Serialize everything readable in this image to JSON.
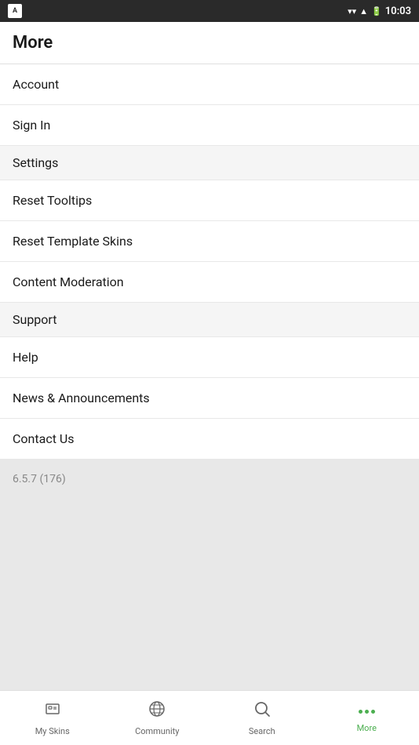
{
  "statusBar": {
    "time": "10:03",
    "icons": [
      "signal",
      "wifi",
      "battery"
    ]
  },
  "header": {
    "title": "More"
  },
  "menu": {
    "items": [
      {
        "id": "account",
        "label": "Account",
        "type": "item"
      },
      {
        "id": "sign-in",
        "label": "Sign In",
        "type": "item"
      },
      {
        "id": "settings",
        "label": "Settings",
        "type": "header"
      },
      {
        "id": "reset-tooltips",
        "label": "Reset Tooltips",
        "type": "item"
      },
      {
        "id": "reset-template-skins",
        "label": "Reset Template Skins",
        "type": "item"
      },
      {
        "id": "content-moderation",
        "label": "Content Moderation",
        "type": "item"
      },
      {
        "id": "support",
        "label": "Support",
        "type": "header"
      },
      {
        "id": "help",
        "label": "Help",
        "type": "item"
      },
      {
        "id": "news-announcements",
        "label": "News & Announcements",
        "type": "item"
      },
      {
        "id": "contact-us",
        "label": "Contact Us",
        "type": "item"
      }
    ],
    "version": "6.5.7 (176)"
  },
  "bottomNav": {
    "items": [
      {
        "id": "my-skins",
        "label": "My Skins",
        "icon": "skins"
      },
      {
        "id": "community",
        "label": "Community",
        "icon": "community"
      },
      {
        "id": "search",
        "label": "Search",
        "icon": "search"
      },
      {
        "id": "more",
        "label": "More",
        "icon": "more",
        "active": true
      }
    ]
  }
}
